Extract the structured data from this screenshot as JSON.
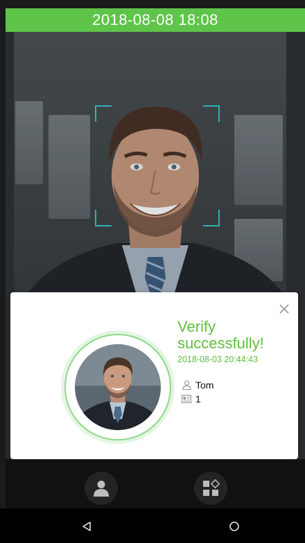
{
  "status_bar": {
    "datetime": "2018-08-08 18:08"
  },
  "dialog": {
    "title": "Verify successfully!",
    "verified_at": "2018-08-03 20:44:43",
    "user_name": "Tom",
    "user_id": "1",
    "icons": {
      "close": "close-icon",
      "name": "person-outline-icon",
      "id": "id-card-icon"
    }
  },
  "toolbar": {
    "icons": [
      "person-icon",
      "apps-grid-icon"
    ]
  },
  "navigation": {
    "icons": [
      "back-icon",
      "home-icon"
    ]
  },
  "colors": {
    "accent_green": "#5fc44a",
    "text_green": "#5fbf3d",
    "face_frame": "#2fb0b9"
  }
}
